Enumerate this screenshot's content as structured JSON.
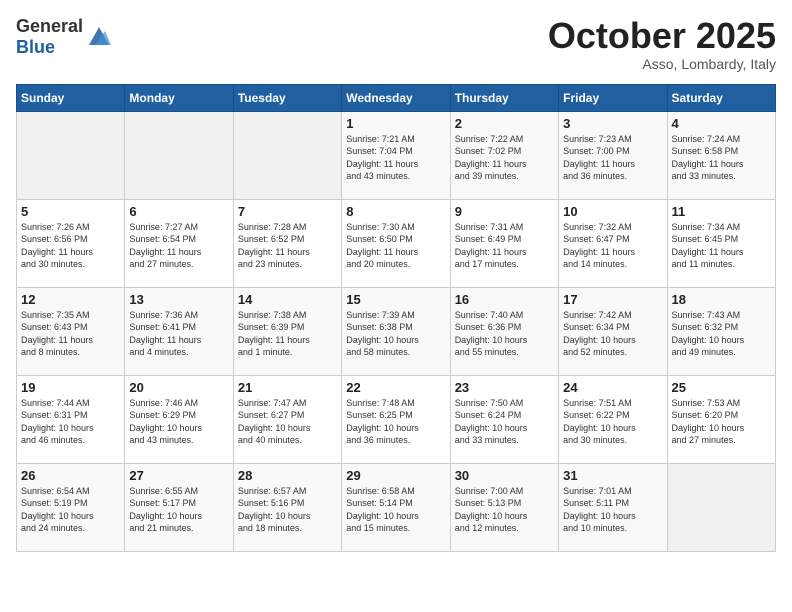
{
  "header": {
    "logo_general": "General",
    "logo_blue": "Blue",
    "month_title": "October 2025",
    "location": "Asso, Lombardy, Italy"
  },
  "days_of_week": [
    "Sunday",
    "Monday",
    "Tuesday",
    "Wednesday",
    "Thursday",
    "Friday",
    "Saturday"
  ],
  "weeks": [
    [
      {
        "day": "",
        "info": ""
      },
      {
        "day": "",
        "info": ""
      },
      {
        "day": "",
        "info": ""
      },
      {
        "day": "1",
        "info": "Sunrise: 7:21 AM\nSunset: 7:04 PM\nDaylight: 11 hours\nand 43 minutes."
      },
      {
        "day": "2",
        "info": "Sunrise: 7:22 AM\nSunset: 7:02 PM\nDaylight: 11 hours\nand 39 minutes."
      },
      {
        "day": "3",
        "info": "Sunrise: 7:23 AM\nSunset: 7:00 PM\nDaylight: 11 hours\nand 36 minutes."
      },
      {
        "day": "4",
        "info": "Sunrise: 7:24 AM\nSunset: 6:58 PM\nDaylight: 11 hours\nand 33 minutes."
      }
    ],
    [
      {
        "day": "5",
        "info": "Sunrise: 7:26 AM\nSunset: 6:56 PM\nDaylight: 11 hours\nand 30 minutes."
      },
      {
        "day": "6",
        "info": "Sunrise: 7:27 AM\nSunset: 6:54 PM\nDaylight: 11 hours\nand 27 minutes."
      },
      {
        "day": "7",
        "info": "Sunrise: 7:28 AM\nSunset: 6:52 PM\nDaylight: 11 hours\nand 23 minutes."
      },
      {
        "day": "8",
        "info": "Sunrise: 7:30 AM\nSunset: 6:50 PM\nDaylight: 11 hours\nand 20 minutes."
      },
      {
        "day": "9",
        "info": "Sunrise: 7:31 AM\nSunset: 6:49 PM\nDaylight: 11 hours\nand 17 minutes."
      },
      {
        "day": "10",
        "info": "Sunrise: 7:32 AM\nSunset: 6:47 PM\nDaylight: 11 hours\nand 14 minutes."
      },
      {
        "day": "11",
        "info": "Sunrise: 7:34 AM\nSunset: 6:45 PM\nDaylight: 11 hours\nand 11 minutes."
      }
    ],
    [
      {
        "day": "12",
        "info": "Sunrise: 7:35 AM\nSunset: 6:43 PM\nDaylight: 11 hours\nand 8 minutes."
      },
      {
        "day": "13",
        "info": "Sunrise: 7:36 AM\nSunset: 6:41 PM\nDaylight: 11 hours\nand 4 minutes."
      },
      {
        "day": "14",
        "info": "Sunrise: 7:38 AM\nSunset: 6:39 PM\nDaylight: 11 hours\nand 1 minute."
      },
      {
        "day": "15",
        "info": "Sunrise: 7:39 AM\nSunset: 6:38 PM\nDaylight: 10 hours\nand 58 minutes."
      },
      {
        "day": "16",
        "info": "Sunrise: 7:40 AM\nSunset: 6:36 PM\nDaylight: 10 hours\nand 55 minutes."
      },
      {
        "day": "17",
        "info": "Sunrise: 7:42 AM\nSunset: 6:34 PM\nDaylight: 10 hours\nand 52 minutes."
      },
      {
        "day": "18",
        "info": "Sunrise: 7:43 AM\nSunset: 6:32 PM\nDaylight: 10 hours\nand 49 minutes."
      }
    ],
    [
      {
        "day": "19",
        "info": "Sunrise: 7:44 AM\nSunset: 6:31 PM\nDaylight: 10 hours\nand 46 minutes."
      },
      {
        "day": "20",
        "info": "Sunrise: 7:46 AM\nSunset: 6:29 PM\nDaylight: 10 hours\nand 43 minutes."
      },
      {
        "day": "21",
        "info": "Sunrise: 7:47 AM\nSunset: 6:27 PM\nDaylight: 10 hours\nand 40 minutes."
      },
      {
        "day": "22",
        "info": "Sunrise: 7:48 AM\nSunset: 6:25 PM\nDaylight: 10 hours\nand 36 minutes."
      },
      {
        "day": "23",
        "info": "Sunrise: 7:50 AM\nSunset: 6:24 PM\nDaylight: 10 hours\nand 33 minutes."
      },
      {
        "day": "24",
        "info": "Sunrise: 7:51 AM\nSunset: 6:22 PM\nDaylight: 10 hours\nand 30 minutes."
      },
      {
        "day": "25",
        "info": "Sunrise: 7:53 AM\nSunset: 6:20 PM\nDaylight: 10 hours\nand 27 minutes."
      }
    ],
    [
      {
        "day": "26",
        "info": "Sunrise: 6:54 AM\nSunset: 5:19 PM\nDaylight: 10 hours\nand 24 minutes."
      },
      {
        "day": "27",
        "info": "Sunrise: 6:55 AM\nSunset: 5:17 PM\nDaylight: 10 hours\nand 21 minutes."
      },
      {
        "day": "28",
        "info": "Sunrise: 6:57 AM\nSunset: 5:16 PM\nDaylight: 10 hours\nand 18 minutes."
      },
      {
        "day": "29",
        "info": "Sunrise: 6:58 AM\nSunset: 5:14 PM\nDaylight: 10 hours\nand 15 minutes."
      },
      {
        "day": "30",
        "info": "Sunrise: 7:00 AM\nSunset: 5:13 PM\nDaylight: 10 hours\nand 12 minutes."
      },
      {
        "day": "31",
        "info": "Sunrise: 7:01 AM\nSunset: 5:11 PM\nDaylight: 10 hours\nand 10 minutes."
      },
      {
        "day": "",
        "info": ""
      }
    ]
  ]
}
